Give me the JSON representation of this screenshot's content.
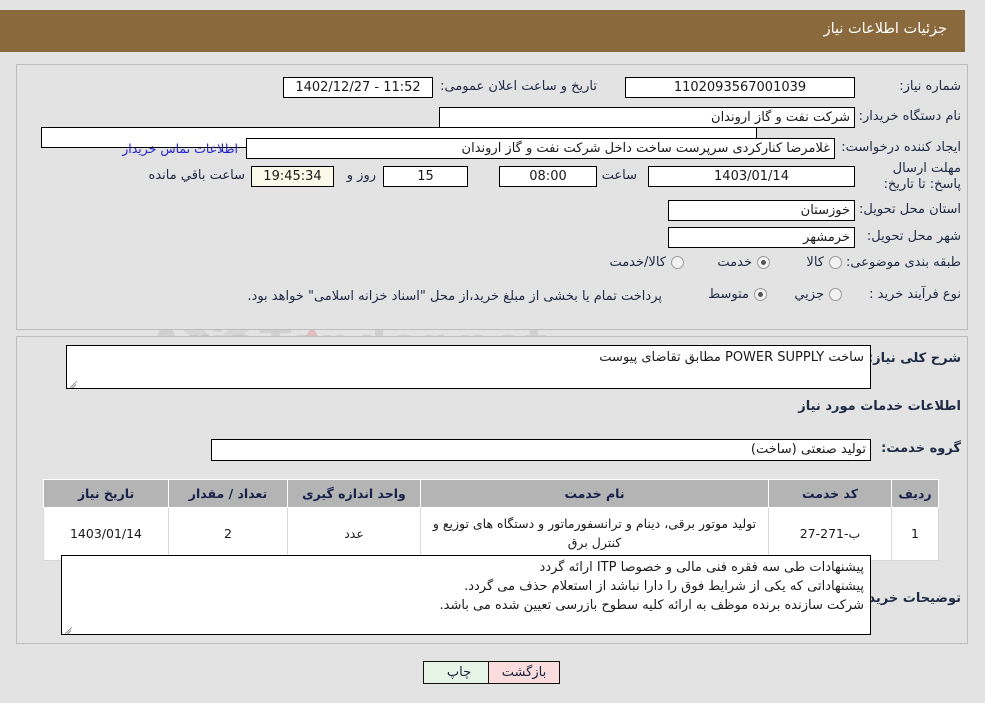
{
  "header": {
    "title": "جزئیات اطلاعات نیاز",
    "bar_color": "#8a6a3c"
  },
  "watermark": {
    "text": "AriaTender.net"
  },
  "top_section": {
    "need_number": {
      "label": "شماره نیاز:",
      "value": "1102093567001039"
    },
    "announce_datetime": {
      "label": "تاریخ و ساعت اعلان عمومی:",
      "value": "11:52 - 1402/12/27"
    },
    "buyer_org": {
      "label": "نام دستگاه خریدار:",
      "value": "شرکت نفت و گاز اروندان"
    },
    "secondary_org": {
      "value": ""
    },
    "requester": {
      "label": "ایجاد کننده درخواست:",
      "value": "غلامرضا کنارکردی سرپرست ساخت داخل شرکت نفت و گاز اروندان",
      "contact_link": "اطلاعات تماس خریدار"
    },
    "deadline": {
      "label": "مهلت ارسال پاسخ: تا تاریخ:",
      "date": "1403/01/14",
      "hour_label": "ساعت",
      "hour": "08:00",
      "days": "15",
      "days_label": "روز و",
      "remaining": "19:45:34",
      "remaining_label": "ساعت باقي مانده"
    },
    "delivery_province": {
      "label": "استان محل تحویل:",
      "value": "خوزستان"
    },
    "delivery_city": {
      "label": "شهر محل تحویل:",
      "value": "خرمشهر"
    },
    "category": {
      "label": "طبقه بندی موضوعی:",
      "options": [
        "کالا",
        "خدمت",
        "کالا/خدمت"
      ],
      "selected": "خدمت"
    },
    "purchase_type": {
      "label": "نوع فرآیند خرید :",
      "options": [
        "جزیي",
        "متوسط"
      ],
      "selected": "متوسط",
      "payment_note": "پرداخت تمام یا بخشی از مبلغ خرید،از محل \"اسناد خزانه اسلامی\" خواهد بود."
    }
  },
  "mid_section": {
    "general_desc": {
      "label": "شرح کلی نیاز:",
      "value": "ساخت POWER SUPPLY  مطابق تقاضای پیوست"
    },
    "services_heading": "اطلاعات خدمات مورد نیاز",
    "service_group": {
      "label": "گروه خدمت:",
      "value": "تولید صنعتی (ساخت)"
    },
    "table": {
      "columns": [
        "ردیف",
        "کد خدمت",
        "نام خدمت",
        "واحد اندازه گیری",
        "تعداد / مقدار",
        "تاریخ نیاز"
      ],
      "rows": [
        {
          "row_no": "1",
          "service_code": "ب-271-27",
          "service_name": "تولید موتور برقی، دینام و ترانسفورماتور و دستگاه های توزیع و کنترل برق",
          "unit": "عدد",
          "quantity": "2",
          "need_date": "1403/01/14"
        }
      ]
    },
    "buyer_notes": {
      "label": "توضیحات خریدار:",
      "lines": [
        "پیشنهادات طی سه فقره فنی مالی و خصوصا ITP  ارائه گردد",
        "پیشنهاداتی که یکی از شرایط فوق را دارا نباشد از استعلام حذف می گردد.",
        "شرکت سازنده برنده موظف به ارائه کلیه سطوح بازرسی تعیین شده می باشد."
      ]
    }
  },
  "footer": {
    "print_button": "چاپ",
    "back_button": "بازگشت"
  }
}
